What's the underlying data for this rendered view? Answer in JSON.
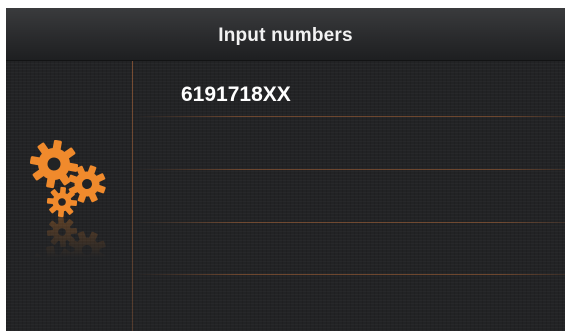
{
  "header": {
    "title": "Input numbers"
  },
  "input": {
    "value": "6191718XX"
  },
  "sidebar": {
    "icon": "gears-icon"
  },
  "colors": {
    "accent": "#f08a2c",
    "background": "#222325",
    "text": "#ffffff"
  }
}
